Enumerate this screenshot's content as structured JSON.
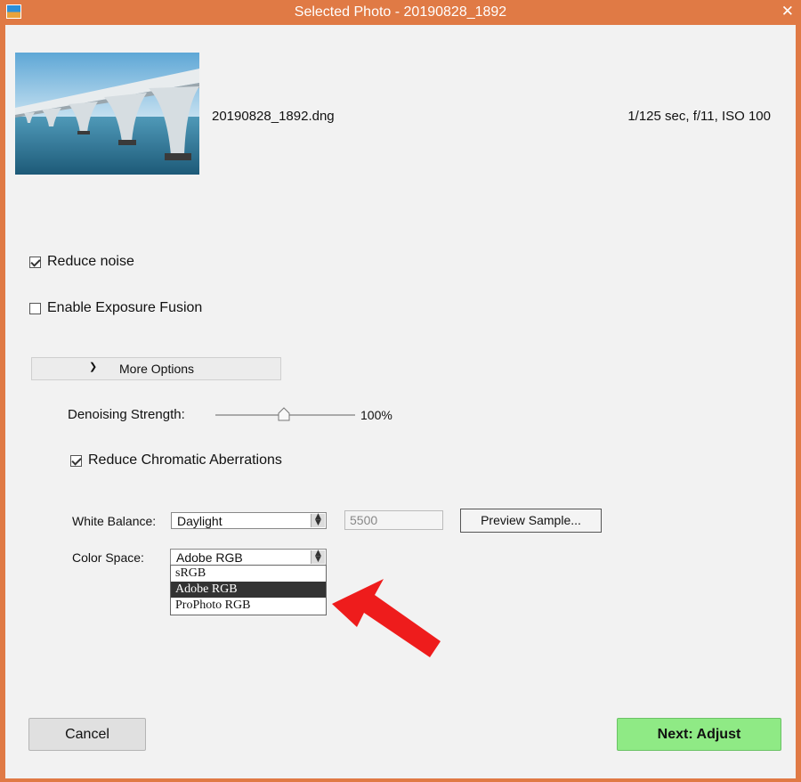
{
  "window": {
    "title": "Selected Photo - 20190828_1892",
    "close_glyph": "✕"
  },
  "photo": {
    "filename": "20190828_1892.dng",
    "exif": "1/125 sec, f/11, ISO 100"
  },
  "options": {
    "reduce_noise_label": "Reduce noise",
    "reduce_noise_checked": true,
    "exposure_fusion_label": "Enable Exposure Fusion",
    "exposure_fusion_checked": false,
    "more_options_label": "More Options"
  },
  "denoise": {
    "label": "Denoising Strength:",
    "value_text": "100%",
    "value": 1.0
  },
  "chromatic": {
    "label": "Reduce Chromatic Aberrations",
    "checked": true
  },
  "white_balance": {
    "label": "White Balance:",
    "value": "Daylight",
    "kelvin": "5500",
    "preview_button": "Preview Sample..."
  },
  "color_space": {
    "label": "Color Space:",
    "value": "Adobe RGB",
    "options": [
      "sRGB",
      "Adobe RGB",
      "ProPhoto RGB"
    ],
    "selected_index": 1
  },
  "buttons": {
    "cancel": "Cancel",
    "next": "Next: Adjust"
  },
  "colors": {
    "frame": "#e07a45",
    "next_button": "#8fea85",
    "annotation_arrow": "#ee1c1c"
  }
}
